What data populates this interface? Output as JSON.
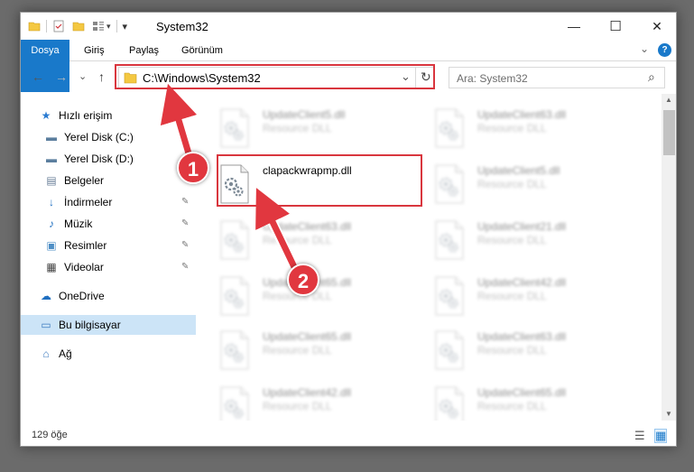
{
  "window": {
    "title": "System32",
    "min_glyph": "—",
    "max_glyph": "☐",
    "close_glyph": "✕"
  },
  "ribbon": {
    "tabs": [
      "Dosya",
      "Giriş",
      "Paylaş",
      "Görünüm"
    ],
    "expand_glyph": "⌄",
    "help_glyph": "?"
  },
  "address": {
    "path": "C:\\Windows\\System32",
    "search_placeholder": "Ara: System32",
    "back_glyph": "←",
    "forward_glyph": "→",
    "recent_glyph": "⌄",
    "up_glyph": "↑",
    "dropdown_glyph": "⌄",
    "refresh_glyph": "↻",
    "search_glyph": "⌕"
  },
  "sidebar": {
    "items": [
      {
        "label": "Hızlı erişim",
        "icon": "star-icon",
        "glyph": "★",
        "color": "#2a7bd1",
        "pinned": false
      },
      {
        "label": "Yerel Disk (C:)",
        "icon": "drive-icon",
        "glyph": "▬",
        "color": "#5b7e9e",
        "pinned": false
      },
      {
        "label": "Yerel Disk (D:)",
        "icon": "drive-icon",
        "glyph": "▬",
        "color": "#5b7e9e",
        "pinned": false
      },
      {
        "label": "Belgeler",
        "icon": "document-icon",
        "glyph": "▤",
        "color": "#6a7f99",
        "pinned": false
      },
      {
        "label": "İndirmeler",
        "icon": "download-icon",
        "glyph": "↓",
        "color": "#1f6fc0",
        "pinned": true
      },
      {
        "label": "Müzik",
        "icon": "music-icon",
        "glyph": "♪",
        "color": "#1f6fc0",
        "pinned": true
      },
      {
        "label": "Resimler",
        "icon": "pictures-icon",
        "glyph": "▣",
        "color": "#4f8fc6",
        "pinned": true
      },
      {
        "label": "Videolar",
        "icon": "video-icon",
        "glyph": "▦",
        "color": "#444444",
        "pinned": true
      },
      {
        "label": "OneDrive",
        "icon": "cloud-icon",
        "glyph": "☁",
        "color": "#1f6fc0",
        "pinned": false
      },
      {
        "label": "Bu bilgisayar",
        "icon": "computer-icon",
        "glyph": "▭",
        "color": "#3d7bbf",
        "pinned": false
      },
      {
        "label": "Ağ",
        "icon": "network-icon",
        "glyph": "⌂",
        "color": "#3d7bbf",
        "pinned": false
      }
    ],
    "pin_glyph": "✎"
  },
  "files": [
    {
      "name": "UpdateClient5.dll",
      "desc": "Resource DLL",
      "blurred": true
    },
    {
      "name": "UpdateClient63.dll",
      "desc": "Resource DLL",
      "blurred": true
    },
    {
      "name": "clapackwrapmp.dll",
      "desc": "",
      "blurred": false
    },
    {
      "name": "UpdateClient5.dll",
      "desc": "Resource DLL",
      "blurred": true
    },
    {
      "name": "UpdateClient63.dll",
      "desc": "Resource DLL",
      "blurred": true
    },
    {
      "name": "UpdateClient21.dll",
      "desc": "Resource DLL",
      "blurred": true
    },
    {
      "name": "UpdateClient65.dll",
      "desc": "Resource DLL",
      "blurred": true
    },
    {
      "name": "UpdateClient42.dll",
      "desc": "Resource DLL",
      "blurred": true
    },
    {
      "name": "UpdateClient65.dll",
      "desc": "Resource DLL",
      "blurred": true
    },
    {
      "name": "UpdateClient63.dll",
      "desc": "Resource DLL",
      "blurred": true
    },
    {
      "name": "UpdateClient42.dll",
      "desc": "Resource DLL",
      "blurred": true
    },
    {
      "name": "UpdateClient65.dll",
      "desc": "Resource DLL",
      "blurred": true
    }
  ],
  "status": {
    "item_count": "129 öğe",
    "details_view_glyph": "☰",
    "tiles_view_glyph": "▦"
  },
  "annotations": {
    "step1": "1",
    "step2": "2",
    "color": "#e1373f"
  },
  "scrollbar": {
    "up_glyph": "▲",
    "down_glyph": "▼"
  }
}
